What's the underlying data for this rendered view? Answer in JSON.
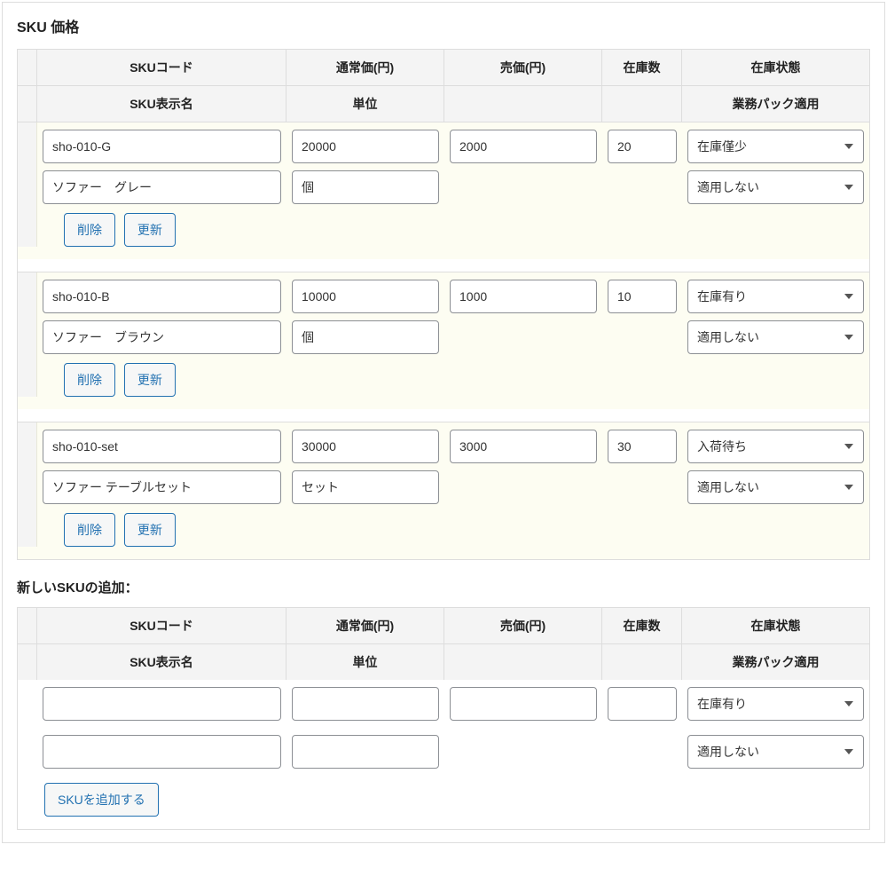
{
  "panel_title": "SKU 価格",
  "headers": {
    "sku_code": "SKUコード",
    "normal_price": "通常価(円)",
    "sale_price": "売価(円)",
    "stock_qty": "在庫数",
    "stock_status": "在庫状態",
    "sku_name": "SKU表示名",
    "unit": "単位",
    "business_pack": "業務パック適用"
  },
  "buttons": {
    "delete": "削除",
    "update": "更新",
    "add_sku": "SKUを追加する"
  },
  "rows": [
    {
      "sku_code": "sho-010-G",
      "normal_price": "20000",
      "sale_price": "2000",
      "stock_qty": "20",
      "stock_status": "在庫僅少",
      "sku_name": "ソファー　グレー",
      "unit": "個",
      "business_pack": "適用しない"
    },
    {
      "sku_code": "sho-010-B",
      "normal_price": "10000",
      "sale_price": "1000",
      "stock_qty": "10",
      "stock_status": "在庫有り",
      "sku_name": "ソファー　ブラウン",
      "unit": "個",
      "business_pack": "適用しない"
    },
    {
      "sku_code": "sho-010-set",
      "normal_price": "30000",
      "sale_price": "3000",
      "stock_qty": "30",
      "stock_status": "入荷待ち",
      "sku_name": "ソファー テーブルセット",
      "unit": "セット",
      "business_pack": "適用しない"
    }
  ],
  "new_section_title": "新しいSKUの追加：",
  "new_row": {
    "sku_code": "",
    "normal_price": "",
    "sale_price": "",
    "stock_qty": "",
    "stock_status": "在庫有り",
    "sku_name": "",
    "unit": "",
    "business_pack": "適用しない"
  }
}
